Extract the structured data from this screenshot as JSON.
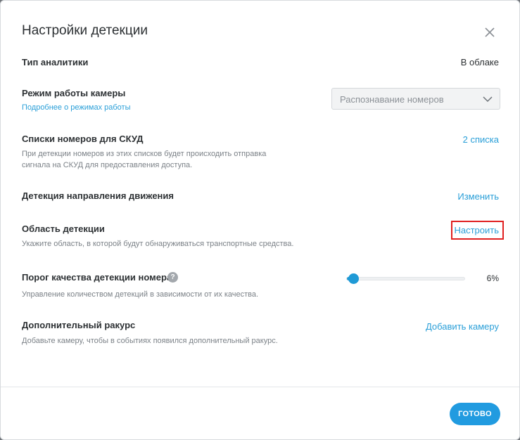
{
  "dialog": {
    "title": "Настройки детекции",
    "close_icon": "close-icon"
  },
  "analytics_type": {
    "label": "Тип аналитики",
    "value": "В облаке"
  },
  "camera_mode": {
    "label": "Режим работы камеры",
    "link": "Подробнее о режимах работы",
    "select_value": "Распознавание номеров",
    "select_icon": "chevron-down-icon"
  },
  "access_lists": {
    "label": "Списки номеров для СКУД",
    "description_line1": "При детекции номеров из этих списков будет происходить отправка",
    "description_line2": "сигнала на СКУД для предоставления доступа.",
    "action": "2 списка"
  },
  "motion_direction": {
    "label": "Детекция направления движения",
    "action": "Изменить"
  },
  "detection_area": {
    "label": "Область детекции",
    "description": "Укажите область, в которой будут обнаруживаться транспортные средства.",
    "action": "Настроить"
  },
  "quality_threshold": {
    "label": "Порог качества детекции номера",
    "help_icon": "help-icon",
    "help_glyph": "?",
    "description": "Управление количеством детекций в зависимости от их качества.",
    "value_percent": 6,
    "value_text": "6%"
  },
  "additional_view": {
    "label": "Дополнительный ракурс",
    "description": "Добавьте камеру, чтобы в событиях появился дополнительный ракурс.",
    "action": "Добавить камеру"
  },
  "footer": {
    "done_label": "ГОТОВО"
  },
  "colors": {
    "accent": "#219be0",
    "link": "#2a9fd8",
    "highlight": "#e02020"
  }
}
